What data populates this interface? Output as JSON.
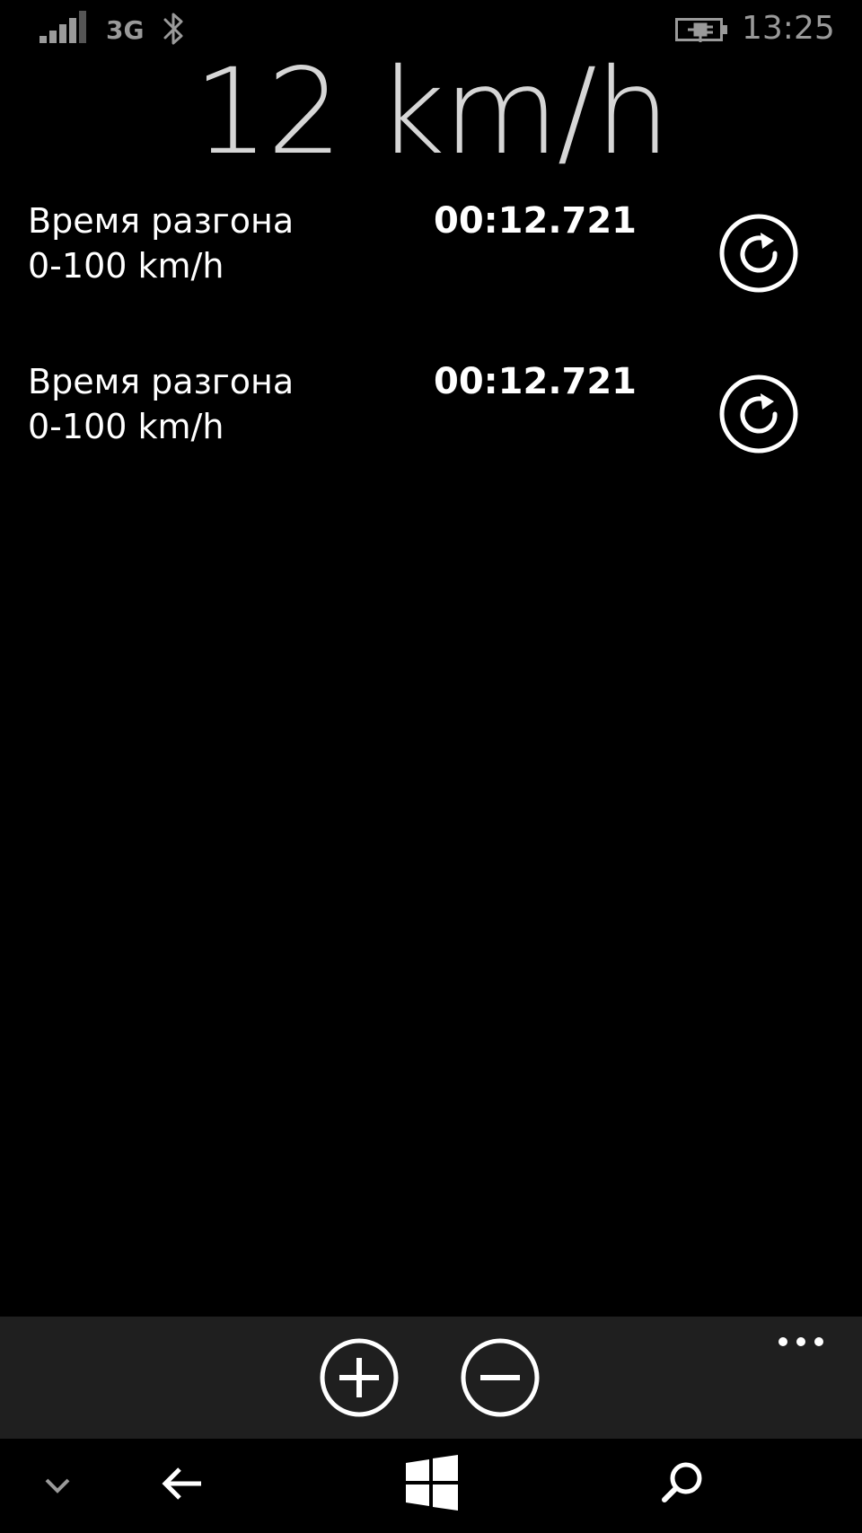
{
  "status_bar": {
    "signal_icon": "signal-strength-icon",
    "network_type": "3G",
    "bluetooth_icon": "bluetooth-icon",
    "battery_icon": "battery-charging-icon",
    "time": "13:25",
    "text_color": "#9a9a9a"
  },
  "speed": {
    "value": "12 km/h",
    "color": "#d6d6d6"
  },
  "records": [
    {
      "label_line1": "Время разгона",
      "label_line2": "0-100 km/h",
      "time": "00:12.721",
      "reset_icon": "refresh-icon"
    },
    {
      "label_line1": "Время разгона",
      "label_line2": "0-100 km/h",
      "time": "00:12.721",
      "reset_icon": "refresh-icon"
    }
  ],
  "app_bar": {
    "background": "#1f1f1f",
    "buttons": [
      {
        "icon": "add-circle-icon"
      },
      {
        "icon": "remove-circle-icon"
      }
    ],
    "more_icon": "ellipsis-icon"
  },
  "nav_bar": {
    "icons": [
      "chevron-down-icon",
      "back-arrow-icon",
      "windows-start-icon",
      "search-icon"
    ]
  }
}
